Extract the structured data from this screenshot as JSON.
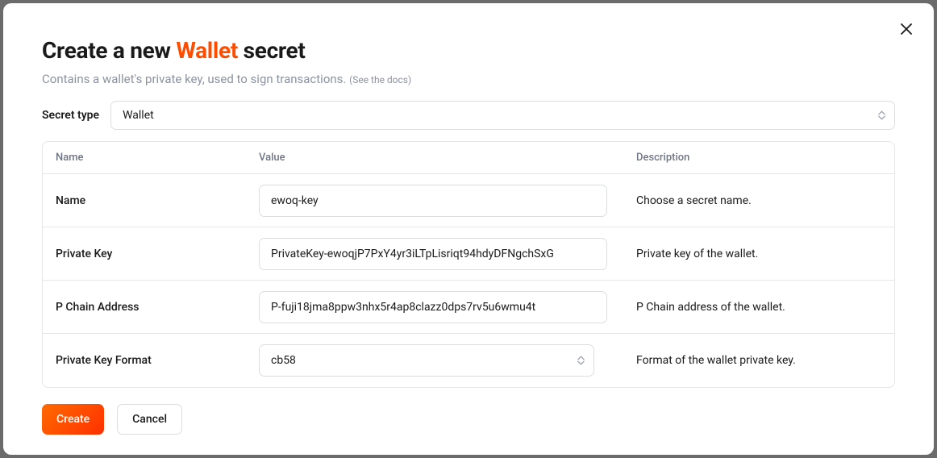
{
  "modal": {
    "title_prefix": "Create a new ",
    "title_accent": "Wallet",
    "title_suffix": " secret",
    "subtitle": "Contains a wallet's private key, used to sign transactions.",
    "docs_link": "(See the docs)"
  },
  "secret_type": {
    "label": "Secret type",
    "value": "Wallet"
  },
  "table": {
    "headers": {
      "name": "Name",
      "value": "Value",
      "description": "Description"
    },
    "rows": [
      {
        "name": "Name",
        "value": "ewoq-key",
        "description": "Choose a secret name.",
        "type": "text"
      },
      {
        "name": "Private Key",
        "value": "PrivateKey-ewoqjP7PxY4yr3iLTpLisriqt94hdyDFNgchSxG",
        "description": "Private key of the wallet.",
        "type": "text"
      },
      {
        "name": "P Chain Address",
        "value": "P-fuji18jma8ppw3nhx5r4ap8clazz0dps7rv5u6wmu4t",
        "description": "P Chain address of the wallet.",
        "type": "text"
      },
      {
        "name": "Private Key Format",
        "value": "cb58",
        "description": "Format of the wallet private key.",
        "type": "select"
      }
    ]
  },
  "buttons": {
    "create": "Create",
    "cancel": "Cancel"
  }
}
